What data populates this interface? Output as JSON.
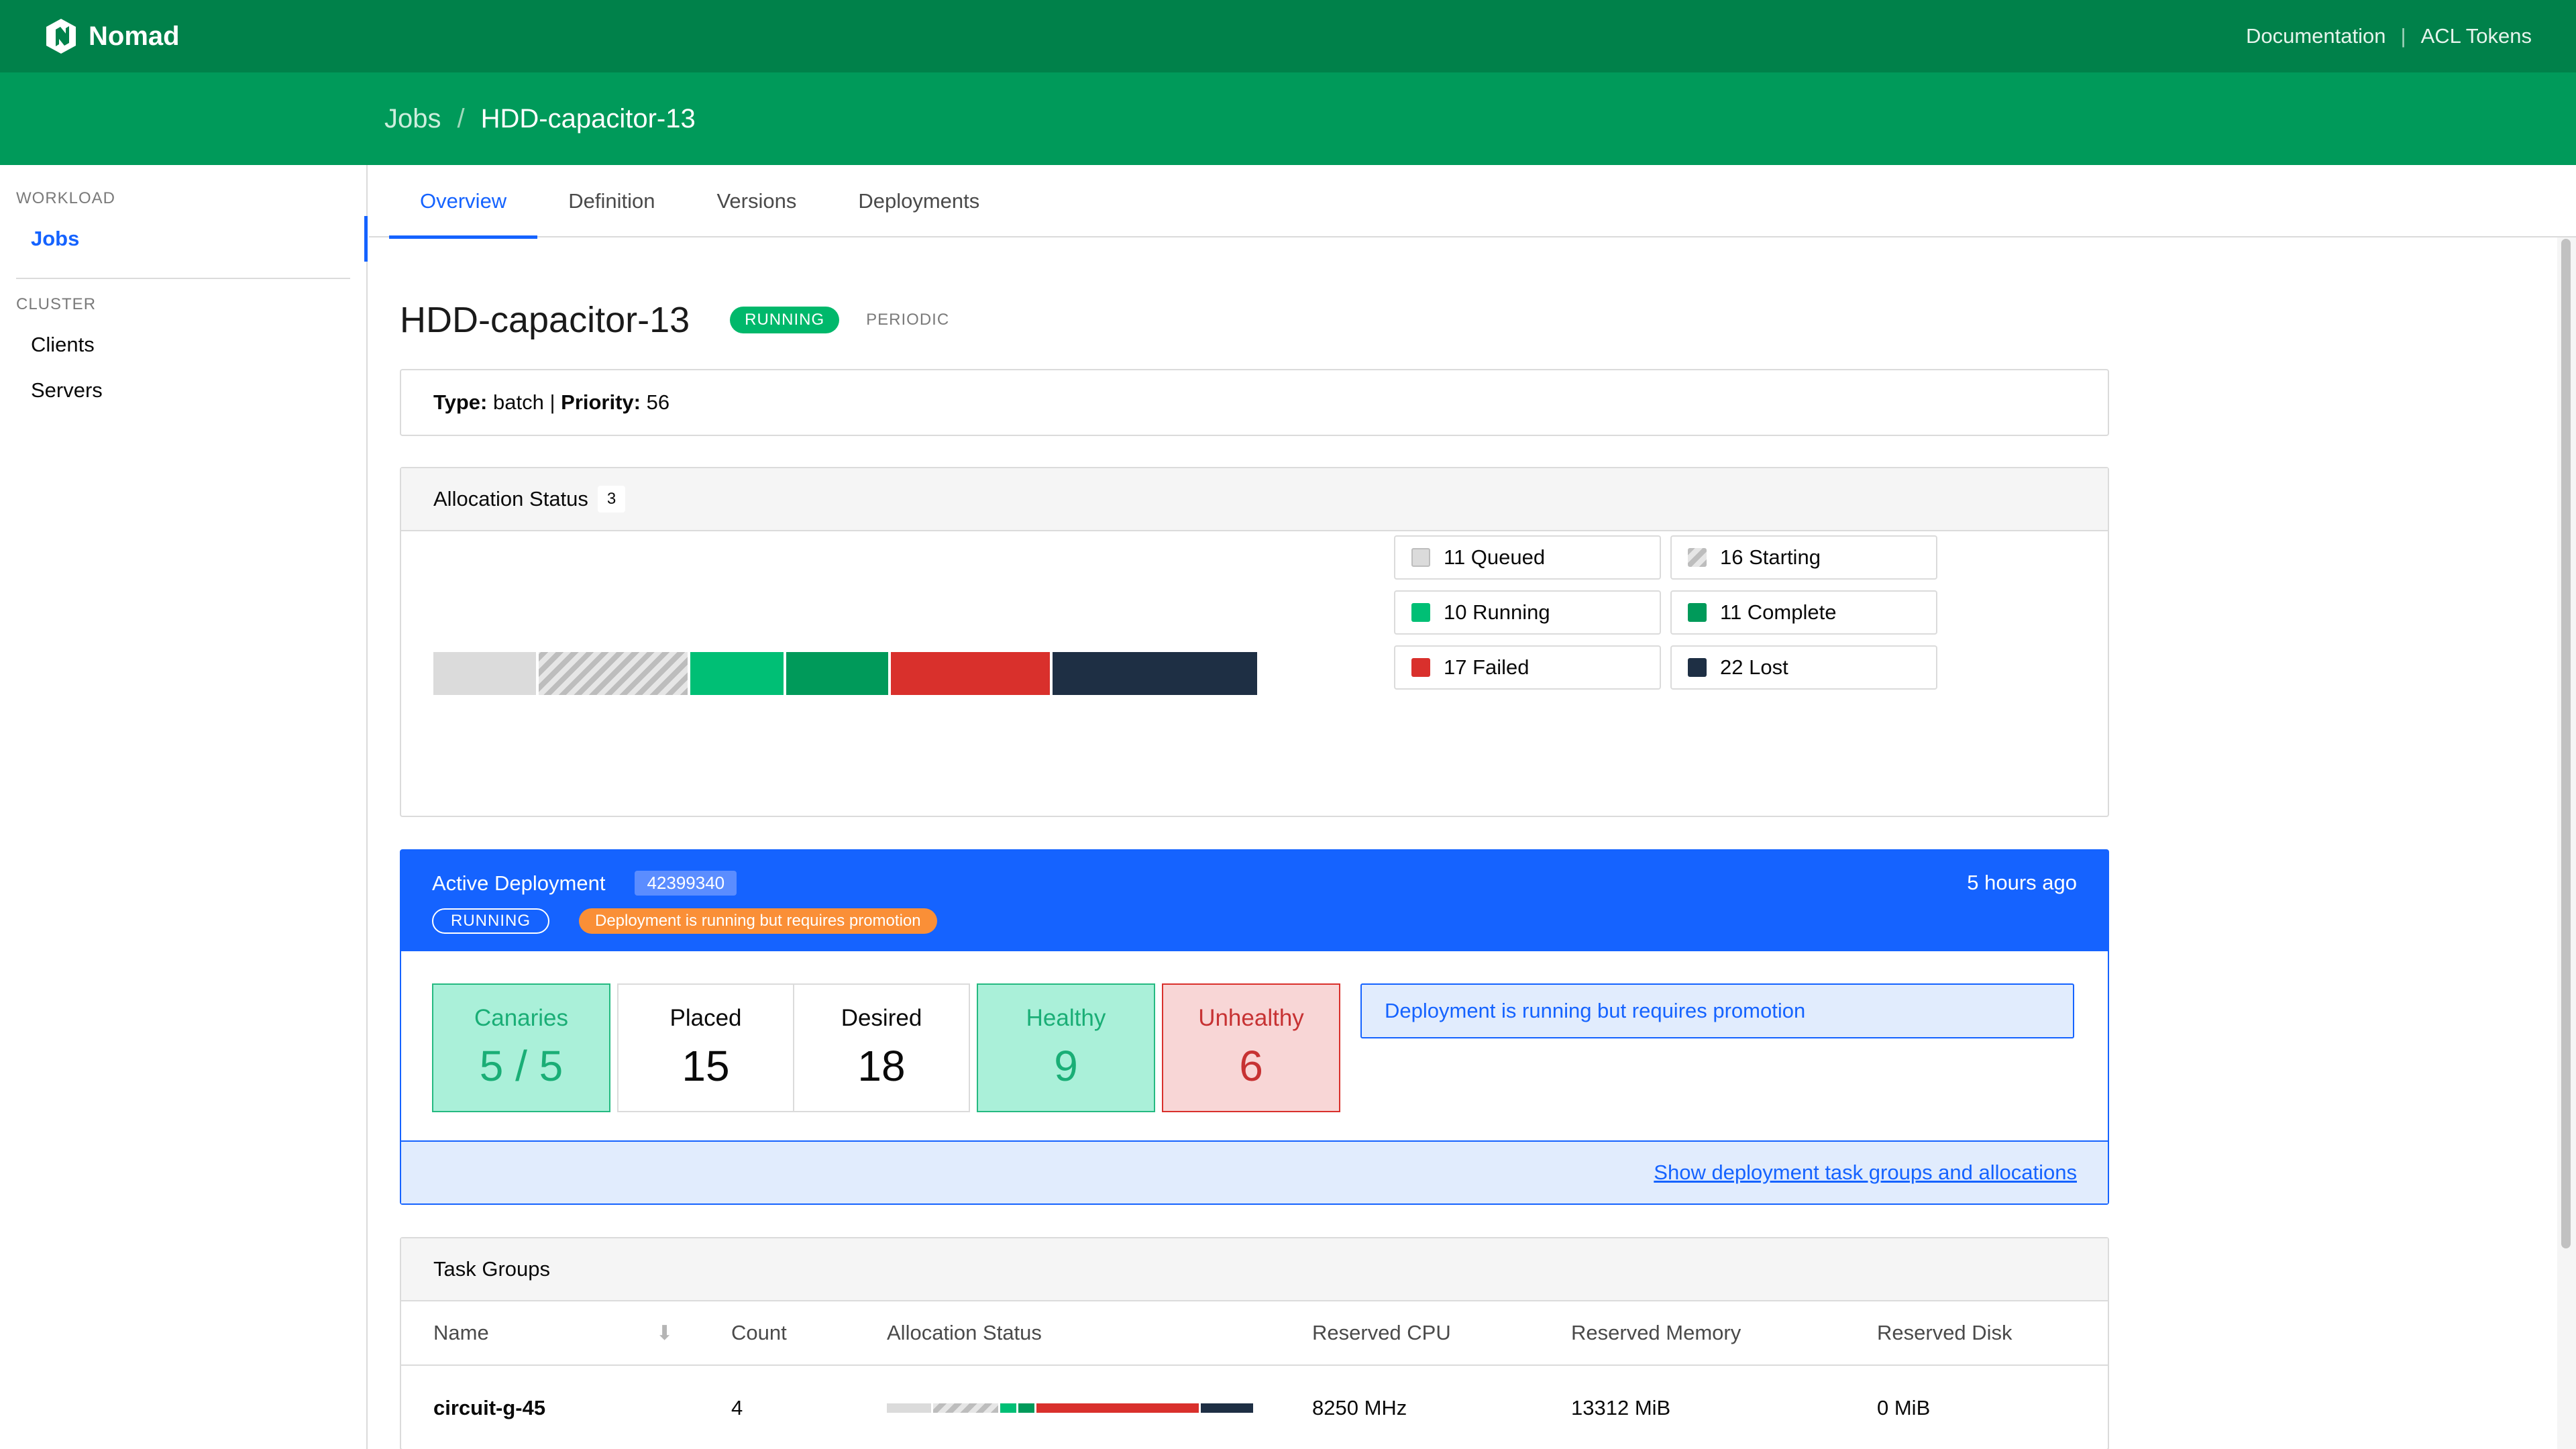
{
  "header": {
    "brand": "Nomad",
    "links": [
      "Documentation",
      "ACL Tokens"
    ]
  },
  "breadcrumb": {
    "root": "Jobs",
    "current": "HDD-capacitor-13"
  },
  "sidebar": {
    "sections": [
      {
        "title": "WORKLOAD",
        "items": [
          "Jobs"
        ]
      },
      {
        "title": "CLUSTER",
        "items": [
          "Clients",
          "Servers"
        ]
      }
    ],
    "active": "Jobs"
  },
  "tabs": [
    "Overview",
    "Definition",
    "Versions",
    "Deployments"
  ],
  "job": {
    "name": "HDD-capacitor-13",
    "status": "RUNNING",
    "kind": "PERIODIC",
    "type_label": "Type:",
    "type": "batch",
    "priority_label": "Priority:",
    "priority": "56"
  },
  "allocation": {
    "title": "Allocation Status",
    "count": "3",
    "legend": [
      {
        "label": "11 Queued",
        "value": 11,
        "key": "queued"
      },
      {
        "label": "16 Starting",
        "value": 16,
        "key": "starting"
      },
      {
        "label": "10 Running",
        "value": 10,
        "key": "running"
      },
      {
        "label": "11 Complete",
        "value": 11,
        "key": "complete"
      },
      {
        "label": "17 Failed",
        "value": 17,
        "key": "failed"
      },
      {
        "label": "22 Lost",
        "value": 22,
        "key": "lost"
      }
    ],
    "colors": {
      "queued": "#dbdbdb",
      "starting": "#bdbdbd",
      "running": "#00bf75",
      "complete": "#009a5a",
      "failed": "#d9302c",
      "lost": "#1e2f44"
    }
  },
  "deployment": {
    "title": "Active Deployment",
    "id": "42399340",
    "time": "5 hours ago",
    "status": "RUNNING",
    "warning": "Deployment is running but requires promotion",
    "stats": {
      "canaries_label": "Canaries",
      "canaries": "5 / 5",
      "placed_label": "Placed",
      "placed": "15",
      "desired_label": "Desired",
      "desired": "18",
      "healthy_label": "Healthy",
      "healthy": "9",
      "unhealthy_label": "Unhealthy",
      "unhealthy": "6"
    },
    "note": "Deployment is running but requires promotion",
    "footer_link": "Show deployment task groups and allocations"
  },
  "task_groups": {
    "title": "Task Groups",
    "columns": [
      "Name",
      "Count",
      "Allocation Status",
      "Reserved CPU",
      "Reserved Memory",
      "Reserved Disk"
    ],
    "rows": [
      {
        "name": "circuit-g-45",
        "count": "4",
        "alloc": {
          "queued": 11,
          "starting": 16,
          "running": 4,
          "complete": 4,
          "failed": 40,
          "lost": 13
        },
        "cpu": "8250 MHz",
        "memory": "13312 MiB",
        "disk": "0 MiB"
      }
    ]
  }
}
